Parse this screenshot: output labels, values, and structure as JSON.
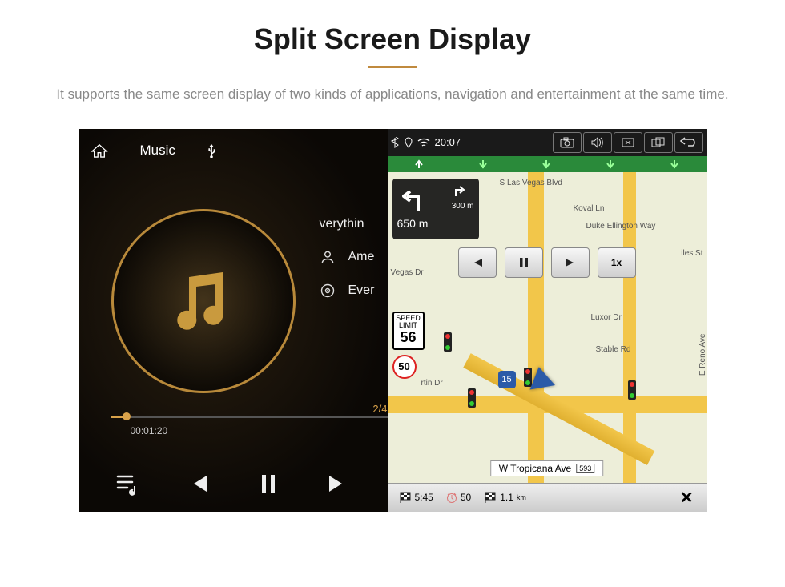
{
  "page": {
    "title": "Split Screen Display",
    "subtitle": "It supports the same screen display of two kinds of applications, navigation and entertainment at the same time."
  },
  "music": {
    "header_label": "Music",
    "song1": "verythin",
    "song2": "Ame",
    "song3": "Ever",
    "track_counter": "2/4",
    "elapsed": "00:01:20"
  },
  "status": {
    "time": "20:07"
  },
  "turn": {
    "dist_top": "300 m",
    "dist_main": "650 m"
  },
  "speed": {
    "label": "SPEED LIMIT",
    "value": "56"
  },
  "shield": {
    "value": "50"
  },
  "controls": {
    "speed_mult": "1x"
  },
  "streets": {
    "s_las_vegas": "S Las Vegas Blvd",
    "koval": "Koval Ln",
    "duke": "Duke Ellington Way",
    "giles": "iles St",
    "vegas_dr": "Vegas Dr",
    "luxor": "Luxor Dr",
    "reno": "E Reno Ave",
    "stable": "Stable Rd",
    "rtin": "rtin Dr",
    "hwy": "15",
    "current": "W Tropicana Ave",
    "current_badge": "593"
  },
  "bottom": {
    "eta": "5:45",
    "remain_time": "50",
    "remain_dist": "1.1",
    "remain_unit": "km"
  }
}
